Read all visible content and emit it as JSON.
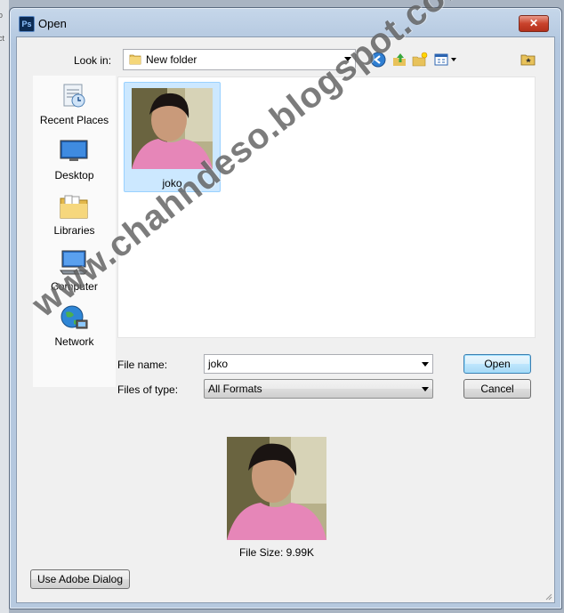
{
  "background": {
    "left_text": [
      "o",
      "ct"
    ]
  },
  "window": {
    "app_icon_text": "Ps",
    "title": "Open",
    "close_label": "✕"
  },
  "toolbar": {
    "look_in_label": "Look in:",
    "look_in_value": "New folder",
    "icons": [
      "back-icon",
      "up-folder-icon",
      "new-folder-icon",
      "view-menu-icon",
      "favorite-folder-icon"
    ]
  },
  "places": [
    {
      "label": "Recent Places",
      "icon": "recent-places-icon"
    },
    {
      "label": "Desktop",
      "icon": "desktop-icon"
    },
    {
      "label": "Libraries",
      "icon": "libraries-icon"
    },
    {
      "label": "Computer",
      "icon": "computer-icon"
    },
    {
      "label": "Network",
      "icon": "network-icon"
    }
  ],
  "files": [
    {
      "name": "joko",
      "selected": true
    }
  ],
  "form": {
    "file_name_label": "File name:",
    "file_name_value": "joko",
    "file_type_label": "Files of type:",
    "file_type_value": "All Formats",
    "open_label": "Open",
    "cancel_label": "Cancel"
  },
  "preview": {
    "file_size": "File Size: 9.99K"
  },
  "footer": {
    "adobe_dialog_label": "Use Adobe Dialog"
  },
  "watermark": "www.chahndeso.blogspot.com",
  "colors": {
    "selection": "#cce8ff",
    "selection_border": "#99d1ff",
    "close_button": "#c9432c",
    "frame": "#b6c9df"
  }
}
